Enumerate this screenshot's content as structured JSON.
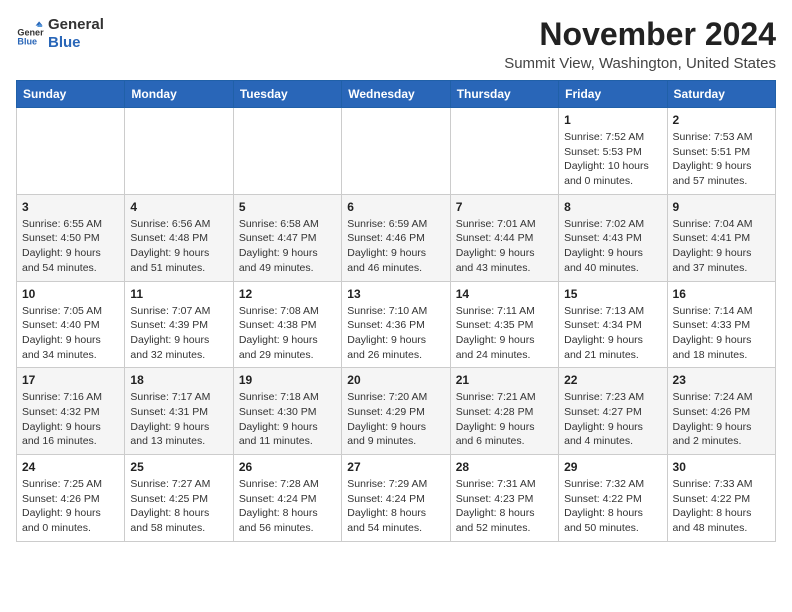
{
  "logo": {
    "line1": "General",
    "line2": "Blue"
  },
  "title": "November 2024",
  "location": "Summit View, Washington, United States",
  "weekdays": [
    "Sunday",
    "Monday",
    "Tuesday",
    "Wednesday",
    "Thursday",
    "Friday",
    "Saturday"
  ],
  "weeks": [
    [
      {
        "day": "",
        "info": ""
      },
      {
        "day": "",
        "info": ""
      },
      {
        "day": "",
        "info": ""
      },
      {
        "day": "",
        "info": ""
      },
      {
        "day": "",
        "info": ""
      },
      {
        "day": "1",
        "info": "Sunrise: 7:52 AM\nSunset: 5:53 PM\nDaylight: 10 hours and 0 minutes."
      },
      {
        "day": "2",
        "info": "Sunrise: 7:53 AM\nSunset: 5:51 PM\nDaylight: 9 hours and 57 minutes."
      }
    ],
    [
      {
        "day": "3",
        "info": "Sunrise: 6:55 AM\nSunset: 4:50 PM\nDaylight: 9 hours and 54 minutes."
      },
      {
        "day": "4",
        "info": "Sunrise: 6:56 AM\nSunset: 4:48 PM\nDaylight: 9 hours and 51 minutes."
      },
      {
        "day": "5",
        "info": "Sunrise: 6:58 AM\nSunset: 4:47 PM\nDaylight: 9 hours and 49 minutes."
      },
      {
        "day": "6",
        "info": "Sunrise: 6:59 AM\nSunset: 4:46 PM\nDaylight: 9 hours and 46 minutes."
      },
      {
        "day": "7",
        "info": "Sunrise: 7:01 AM\nSunset: 4:44 PM\nDaylight: 9 hours and 43 minutes."
      },
      {
        "day": "8",
        "info": "Sunrise: 7:02 AM\nSunset: 4:43 PM\nDaylight: 9 hours and 40 minutes."
      },
      {
        "day": "9",
        "info": "Sunrise: 7:04 AM\nSunset: 4:41 PM\nDaylight: 9 hours and 37 minutes."
      }
    ],
    [
      {
        "day": "10",
        "info": "Sunrise: 7:05 AM\nSunset: 4:40 PM\nDaylight: 9 hours and 34 minutes."
      },
      {
        "day": "11",
        "info": "Sunrise: 7:07 AM\nSunset: 4:39 PM\nDaylight: 9 hours and 32 minutes."
      },
      {
        "day": "12",
        "info": "Sunrise: 7:08 AM\nSunset: 4:38 PM\nDaylight: 9 hours and 29 minutes."
      },
      {
        "day": "13",
        "info": "Sunrise: 7:10 AM\nSunset: 4:36 PM\nDaylight: 9 hours and 26 minutes."
      },
      {
        "day": "14",
        "info": "Sunrise: 7:11 AM\nSunset: 4:35 PM\nDaylight: 9 hours and 24 minutes."
      },
      {
        "day": "15",
        "info": "Sunrise: 7:13 AM\nSunset: 4:34 PM\nDaylight: 9 hours and 21 minutes."
      },
      {
        "day": "16",
        "info": "Sunrise: 7:14 AM\nSunset: 4:33 PM\nDaylight: 9 hours and 18 minutes."
      }
    ],
    [
      {
        "day": "17",
        "info": "Sunrise: 7:16 AM\nSunset: 4:32 PM\nDaylight: 9 hours and 16 minutes."
      },
      {
        "day": "18",
        "info": "Sunrise: 7:17 AM\nSunset: 4:31 PM\nDaylight: 9 hours and 13 minutes."
      },
      {
        "day": "19",
        "info": "Sunrise: 7:18 AM\nSunset: 4:30 PM\nDaylight: 9 hours and 11 minutes."
      },
      {
        "day": "20",
        "info": "Sunrise: 7:20 AM\nSunset: 4:29 PM\nDaylight: 9 hours and 9 minutes."
      },
      {
        "day": "21",
        "info": "Sunrise: 7:21 AM\nSunset: 4:28 PM\nDaylight: 9 hours and 6 minutes."
      },
      {
        "day": "22",
        "info": "Sunrise: 7:23 AM\nSunset: 4:27 PM\nDaylight: 9 hours and 4 minutes."
      },
      {
        "day": "23",
        "info": "Sunrise: 7:24 AM\nSunset: 4:26 PM\nDaylight: 9 hours and 2 minutes."
      }
    ],
    [
      {
        "day": "24",
        "info": "Sunrise: 7:25 AM\nSunset: 4:26 PM\nDaylight: 9 hours and 0 minutes."
      },
      {
        "day": "25",
        "info": "Sunrise: 7:27 AM\nSunset: 4:25 PM\nDaylight: 8 hours and 58 minutes."
      },
      {
        "day": "26",
        "info": "Sunrise: 7:28 AM\nSunset: 4:24 PM\nDaylight: 8 hours and 56 minutes."
      },
      {
        "day": "27",
        "info": "Sunrise: 7:29 AM\nSunset: 4:24 PM\nDaylight: 8 hours and 54 minutes."
      },
      {
        "day": "28",
        "info": "Sunrise: 7:31 AM\nSunset: 4:23 PM\nDaylight: 8 hours and 52 minutes."
      },
      {
        "day": "29",
        "info": "Sunrise: 7:32 AM\nSunset: 4:22 PM\nDaylight: 8 hours and 50 minutes."
      },
      {
        "day": "30",
        "info": "Sunrise: 7:33 AM\nSunset: 4:22 PM\nDaylight: 8 hours and 48 minutes."
      }
    ]
  ]
}
